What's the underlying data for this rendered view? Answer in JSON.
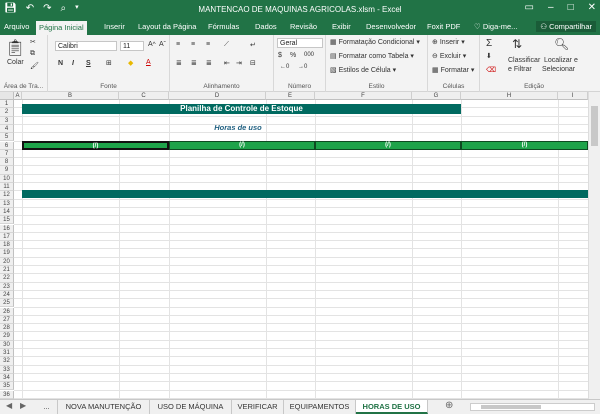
{
  "window": {
    "title": "MANTENCAO DE MAQUINAS AGRICOLAS.xlsm - Excel",
    "quick_access": [
      "save-icon",
      "undo-icon",
      "redo-icon",
      "print-preview-icon"
    ]
  },
  "tabs": [
    "Arquivo",
    "Página Inicial",
    "Inserir",
    "Layout da Página",
    "Fórmulas",
    "Dados",
    "Revisão",
    "Exibir",
    "Desenvolvedor",
    "Foxit PDF",
    "Diga-me..."
  ],
  "active_tab": "Página Inicial",
  "share_label": "Compartilhar",
  "ribbon": {
    "clipboard": {
      "paste": "Colar",
      "label": "Área de Tra..."
    },
    "font": {
      "name": "Calibri",
      "size": "11",
      "bold": "N",
      "italic": "I",
      "underline": "S",
      "label": "Fonte"
    },
    "alignment": {
      "label": "Alinhamento"
    },
    "number": {
      "format": "Geral",
      "percent": "%",
      "thousands": "000",
      "label": "Número"
    },
    "styles": {
      "conditional": "Formatação Condicional",
      "table": "Formatar como Tabela",
      "cell": "Estilos de Célula",
      "label": "Estilo"
    },
    "cells": {
      "insert": "Inserir",
      "delete": "Excluir",
      "format": "Formatar",
      "label": "Células"
    },
    "editing": {
      "sort": "Classificar",
      "sort2": "e Filtrar",
      "find": "Localizar e",
      "find2": "Selecionar",
      "label": "Edição"
    }
  },
  "sheet": {
    "columns": [
      "A",
      "B",
      "C",
      "D",
      "E",
      "F",
      "G",
      "H",
      "I"
    ],
    "rows": [
      "1",
      "2",
      "3",
      "4",
      "5",
      "6",
      "7",
      "8",
      "9",
      "10",
      "11",
      "12",
      "13",
      "14",
      "15",
      "16",
      "17",
      "18",
      "19",
      "20",
      "21",
      "22",
      "23",
      "24",
      "25",
      "26",
      "27",
      "28",
      "29",
      "30",
      "31",
      "32",
      "33",
      "34",
      "35",
      "36"
    ],
    "title": "Planilha de Controle de Estoque",
    "subtitle": "Horas de uso",
    "header_cells": [
      "(/)",
      "(/)",
      "(/)",
      "(/)"
    ]
  },
  "sheet_tabs": [
    "...",
    "NOVA MANUTENÇÃO",
    "USO DE MÁQUINA",
    "VERIFICAR",
    "EQUIPAMENTOS",
    "HORAS DE USO"
  ],
  "active_sheet": "HORAS DE USO",
  "colors": {
    "excel_green": "#217346",
    "banner": "#006a60",
    "header_green": "#1ea34a"
  }
}
